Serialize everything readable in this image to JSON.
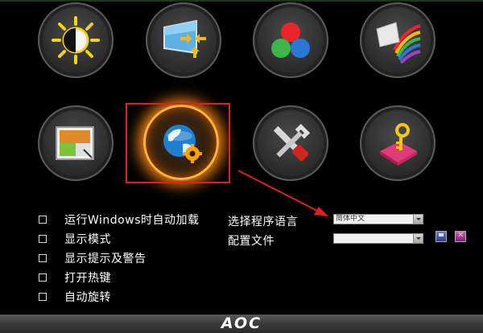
{
  "options": [
    {
      "label": "运行Windows时自动加载",
      "checked": false
    },
    {
      "label": "显示模式",
      "checked": false
    },
    {
      "label": "显示提示及警告",
      "checked": false
    },
    {
      "label": "打开热键",
      "checked": false
    },
    {
      "label": "自动旋转",
      "checked": false
    }
  ],
  "language": {
    "label": "选择程序语言",
    "selected": "简体中文"
  },
  "profile": {
    "label": "配置文件",
    "selected": ""
  },
  "footer": {
    "logo": "AOC"
  },
  "icons": [
    "brightness-contrast-icon",
    "screen-resize-icon",
    "color-rgb-icon",
    "color-palette-paint-icon",
    "picture-image-icon",
    "globe-settings-icon",
    "tools-wrench-screwdriver-icon",
    "key-lock-icon"
  ],
  "colors": {
    "highlight_box": "#e0201c",
    "selected_glow": "#ff8a1a",
    "background": "#000000"
  }
}
